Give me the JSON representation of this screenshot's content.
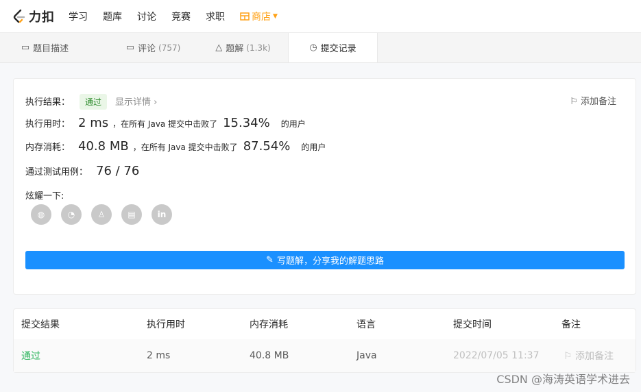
{
  "nav": {
    "logo_text": "力扣",
    "items": [
      "学习",
      "题库",
      "讨论",
      "竞赛",
      "求职"
    ],
    "store_label": "商店"
  },
  "tabs": [
    {
      "label": "题目描述",
      "count": "",
      "icon": "description-icon"
    },
    {
      "label": "评论",
      "count": "(757)",
      "icon": "comment-icon"
    },
    {
      "label": "题解",
      "count": "(1.3k)",
      "icon": "flask-icon"
    },
    {
      "label": "提交记录",
      "count": "",
      "icon": "clock-icon"
    }
  ],
  "result": {
    "status_label": "执行结果：",
    "status": "通过",
    "detail_link": "显示详情",
    "add_note": "添加备注",
    "runtime_label": "执行用时：",
    "runtime": "2 ms",
    "runtime_text": "，在所有 Java 提交中击败了",
    "runtime_pct": "15.34%",
    "runtime_suffix": "的用户",
    "memory_label": "内存消耗：",
    "memory": "40.8 MB",
    "memory_text": "，在所有 Java 提交中击败了",
    "memory_pct": "87.54%",
    "memory_suffix": "的用户",
    "testcases_label": "通过测试用例：",
    "testcases": "76 / 76",
    "share_label": "炫耀一下:",
    "share_icons": [
      "wechat-icon",
      "weibo-icon",
      "qq-icon",
      "douban-icon",
      "linkedin-icon"
    ],
    "write_button": "写题解，分享我的解题思路"
  },
  "table": {
    "headers": [
      "提交结果",
      "执行用时",
      "内存消耗",
      "语言",
      "提交时间",
      "备注"
    ],
    "rows": [
      {
        "result": "通过",
        "runtime": "2 ms",
        "memory": "40.8 MB",
        "language": "Java",
        "time": "2022/07/05 11:37",
        "note": "添加备注"
      }
    ]
  },
  "colors": {
    "accent": "#1a90ff",
    "pass": "#2db55d",
    "store": "#ffa116"
  },
  "watermark": "CSDN @海涛英语学术进去"
}
